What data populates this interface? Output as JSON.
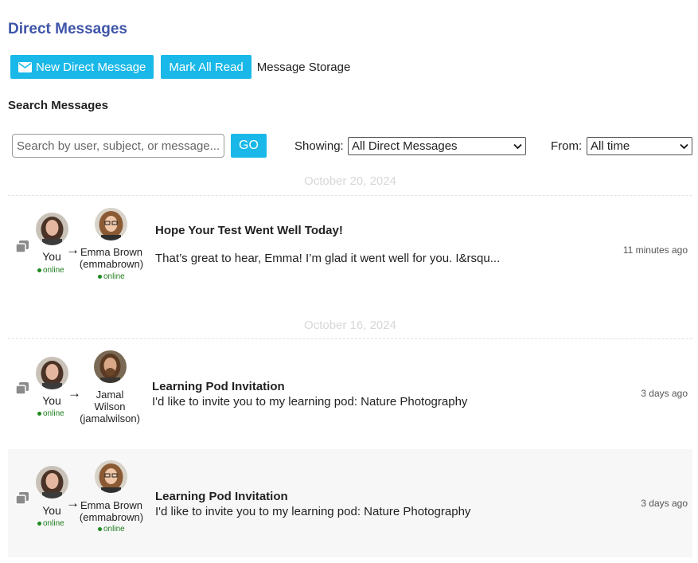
{
  "page": {
    "title": "Direct Messages"
  },
  "toolbar": {
    "new_message_label": "New Direct Message",
    "mark_all_read_label": "Mark All Read",
    "storage_label": "Message Storage"
  },
  "search": {
    "heading": "Search Messages",
    "placeholder": "Search by user, subject, or message...",
    "go_label": "GO",
    "showing_label": "Showing:",
    "showing_value": "All Direct Messages",
    "from_label": "From:",
    "from_value": "All time"
  },
  "colors": {
    "accent": "#19b8e8",
    "title": "#3f55a8",
    "online": "#1e8a1e"
  },
  "groups": [
    {
      "date": "October 20, 2024",
      "messages": [
        {
          "sender": "You",
          "sender_status": "online",
          "recipient": "Emma Brown",
          "recipient_handle": "(emmabrown)",
          "recipient_status": "online",
          "subject": "Hope Your Test Went Well Today!",
          "preview": "That’s great to hear, Emma! I’m glad it went well for you. I&rsqu...",
          "time": "11 minutes ago"
        }
      ]
    },
    {
      "date": "October 16, 2024",
      "messages": [
        {
          "sender": "You",
          "sender_status": "online",
          "recipient_line1": "Jamal",
          "recipient_line2": "Wilson",
          "recipient_handle": "(jamalwilson)",
          "subject": "Learning Pod Invitation",
          "preview": "I'd like to invite you to my learning pod: Nature Photography",
          "time": "3 days ago"
        },
        {
          "sender": "You",
          "sender_status": "online",
          "recipient": "Emma Brown",
          "recipient_handle": "(emmabrown)",
          "recipient_status": "online",
          "subject": "Learning Pod Invitation",
          "preview": "I'd like to invite you to my learning pod: Nature Photography",
          "time": "3 days ago"
        }
      ]
    }
  ],
  "icons": {
    "envelope": "envelope-icon",
    "copy": "copy-messages-icon",
    "chevron": "chevron-down-icon"
  }
}
